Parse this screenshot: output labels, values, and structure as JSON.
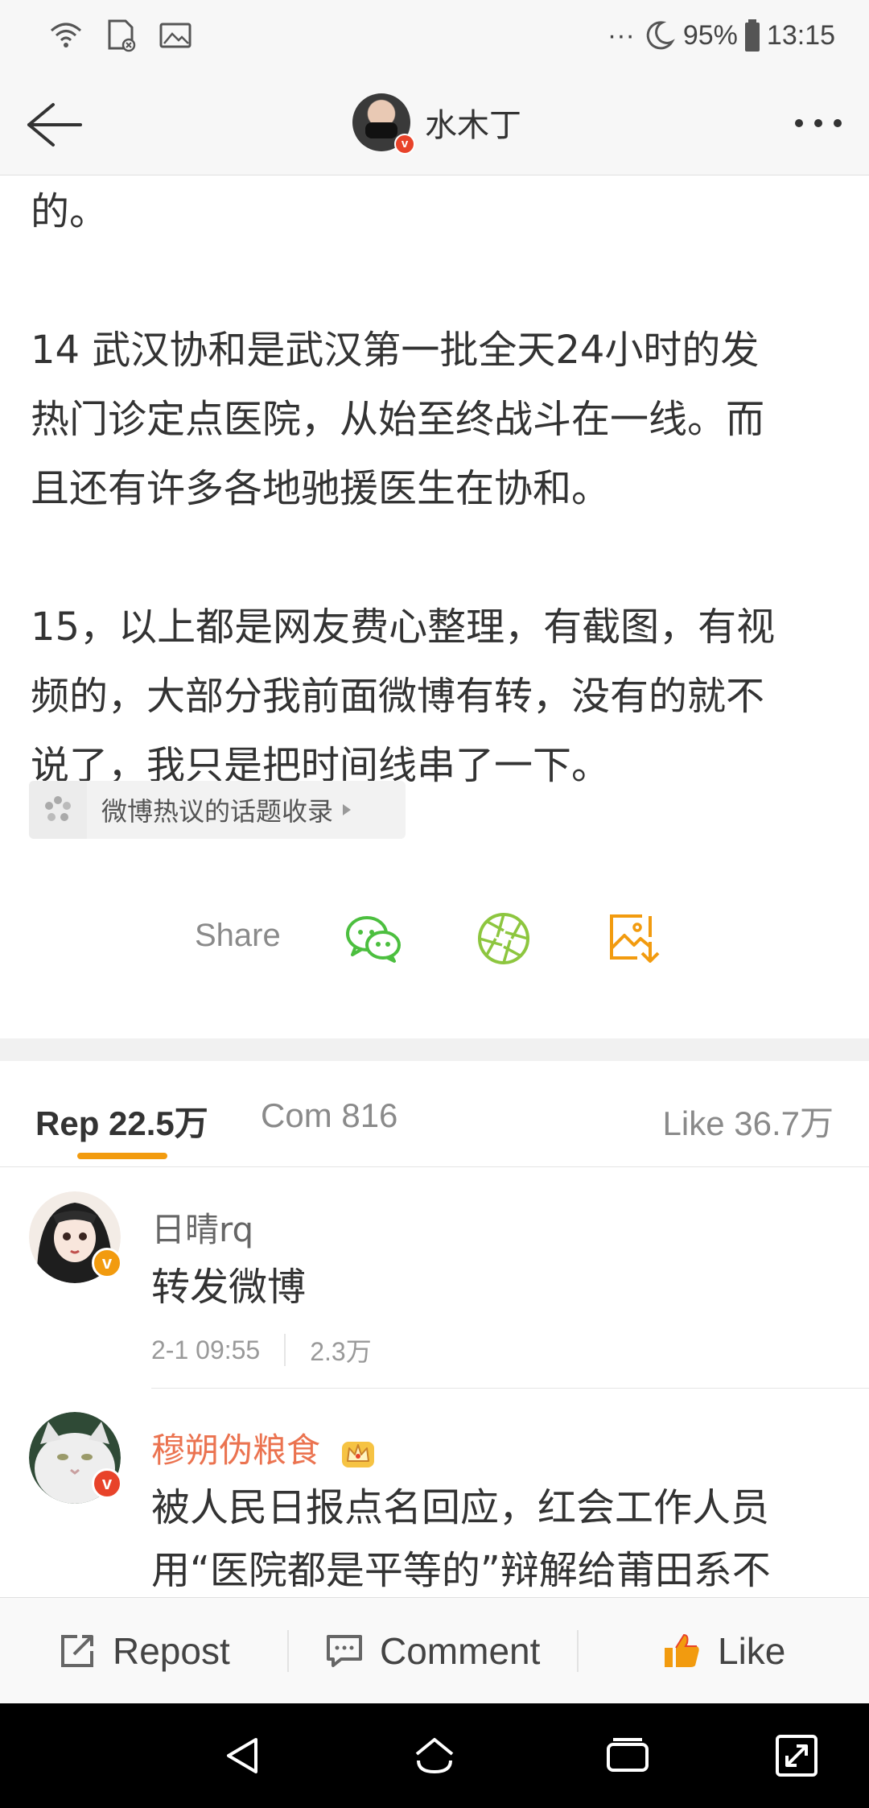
{
  "status_bar": {
    "dots": "···",
    "battery": "95%",
    "time": "13:15"
  },
  "header": {
    "title": "水木丁",
    "verified_badge": "v"
  },
  "article": {
    "lines": [
      "的。",
      "",
      "14 武汉协和是武汉第一批全天24小时的发",
      "热门诊定点医院，从始至终战斗在一线。而",
      "且还有许多各地驰援医生在协和。",
      "",
      "15，以上都是网友费心整理，有截图，有视",
      "频的，大部分我前面微博有转，没有的就不",
      "说了，我只是把时间线串了一下。"
    ]
  },
  "topic_chip": {
    "label": "微博热议的话题收录"
  },
  "share": {
    "label": "Share",
    "icons": [
      "wechat-icon",
      "moments-icon",
      "save-image-icon"
    ]
  },
  "tabs": {
    "repost": "Rep 22.5万",
    "comment": "Com 816",
    "like": "Like 36.7万"
  },
  "comments": [
    {
      "name": "日晴rq",
      "text": "转发微博",
      "time": "2-1 09:55",
      "likes": "2.3万",
      "badge": "v"
    },
    {
      "name": "穆朔伪粮食",
      "text_line1": "被人民日报点名回应，红会工作人员",
      "text_line2": "用“医院都是平等的”辩解给莆田系不",
      "badge": "v"
    }
  ],
  "action_bar": {
    "repost": "Repost",
    "comment": "Comment",
    "like": "Like"
  },
  "colors": {
    "accent": "#f29b0f",
    "name_orange": "#eb7350",
    "wechat_green": "#4cbf3f",
    "moments_green": "#8dc63f"
  }
}
